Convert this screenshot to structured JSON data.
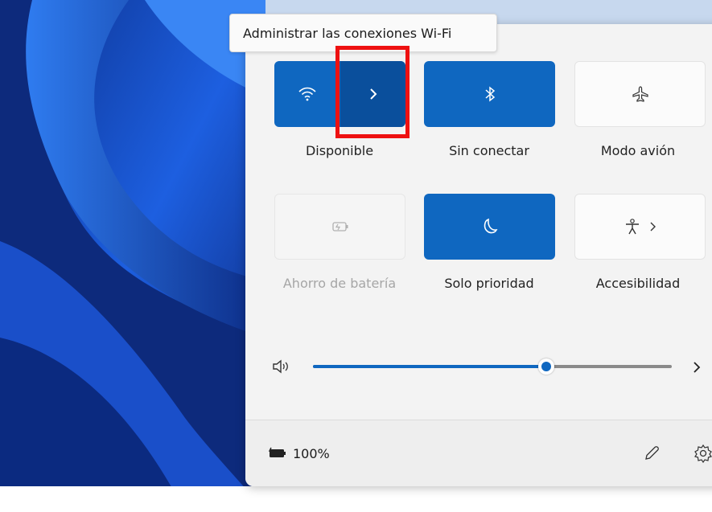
{
  "tooltip": {
    "text": "Administrar las conexiones Wi-Fi"
  },
  "tiles": [
    {
      "id": "wifi",
      "label": "Disponible",
      "state": "on",
      "icon": "wifi-icon",
      "has_chevron": true
    },
    {
      "id": "bluetooth",
      "label": "Sin conectar",
      "state": "on",
      "icon": "bluetooth-icon"
    },
    {
      "id": "airplane",
      "label": "Modo avión",
      "state": "off",
      "icon": "airplane-icon"
    },
    {
      "id": "battery-saver",
      "label": "Ahorro de batería",
      "state": "disabled",
      "icon": "battery-saver-icon"
    },
    {
      "id": "focus",
      "label": "Solo prioridad",
      "state": "on",
      "icon": "moon-icon"
    },
    {
      "id": "accessibility",
      "label": "Accesibilidad",
      "state": "off",
      "icon": "accessibility-icon",
      "has_chevron": true
    }
  ],
  "volume": {
    "level": 0.65,
    "icon": "speaker-icon"
  },
  "footer": {
    "battery_text": "100%",
    "battery_icon": "battery-charging-icon"
  },
  "colors": {
    "accent": "#0f67c0",
    "accent_dark": "#0a4f9c",
    "highlight": "#ee1111"
  }
}
